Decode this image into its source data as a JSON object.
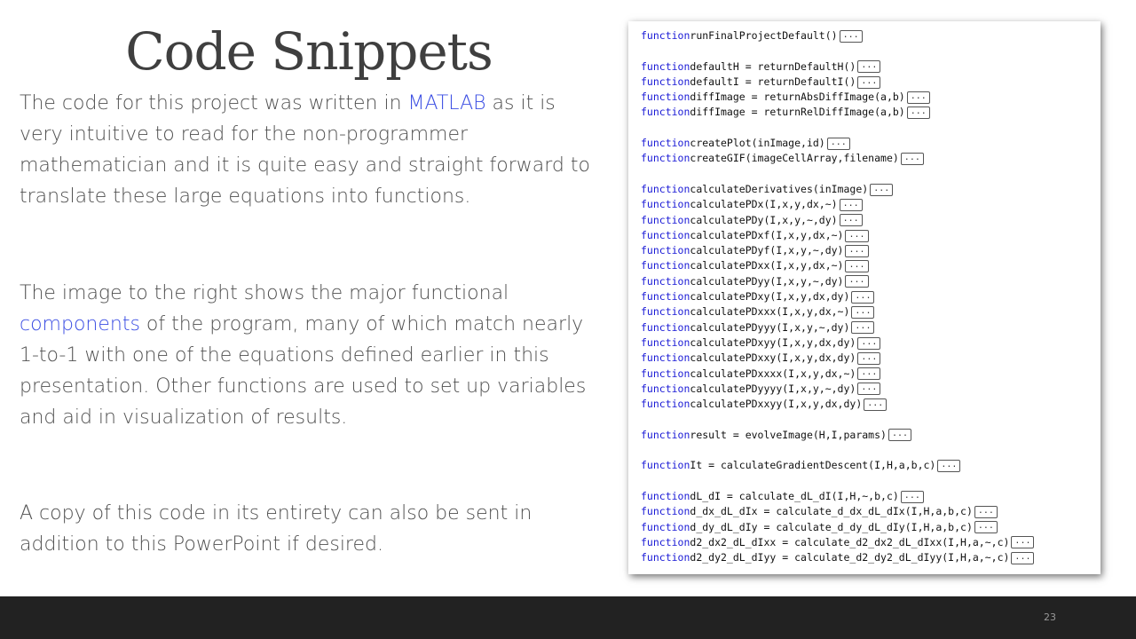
{
  "slide": {
    "title": "Code Snippets",
    "page_number": "23"
  },
  "paragraphs": {
    "p1": {
      "before": "The code for this project was written in ",
      "link": "MATLAB",
      "after": " as it is very intuitive to read for the non-programmer mathematician and it is quite easy and straight forward to translate these large equations into functions."
    },
    "p2": {
      "before": "The image to the right shows the major functional ",
      "link": "components",
      "after": " of the program, many of which match nearly 1-to-1 with one of the equations defined earlier in this presentation.  Other functions are used to set up variables and aid in visualization of results."
    },
    "p3": {
      "text": "A copy of this code in its entirety can also be sent in addition to this PowerPoint if desired."
    }
  },
  "code": {
    "keyword": "function",
    "fold_label": "...",
    "lines": [
      "runFinalProjectDefault()",
      "",
      "defaultH = returnDefaultH()",
      "defaultI = returnDefaultI()",
      "diffImage = returnAbsDiffImage(a,b)",
      "diffImage = returnRelDiffImage(a,b)",
      "",
      "createPlot(inImage,id)",
      "createGIF(imageCellArray,filename)",
      "",
      "calculateDerivatives(inImage)",
      "calculatePDx(I,x,y,dx,~)",
      "calculatePDy(I,x,y,~,dy)",
      "calculatePDxf(I,x,y,dx,~)",
      "calculatePDyf(I,x,y,~,dy)",
      "calculatePDxx(I,x,y,dx,~)",
      "calculatePDyy(I,x,y,~,dy)",
      "calculatePDxy(I,x,y,dx,dy)",
      "calculatePDxxx(I,x,y,dx,~)",
      "calculatePDyyy(I,x,y,~,dy)",
      "calculatePDxyy(I,x,y,dx,dy)",
      "calculatePDxxy(I,x,y,dx,dy)",
      "calculatePDxxxx(I,x,y,dx,~)",
      "calculatePDyyyy(I,x,y,~,dy)",
      "calculatePDxxyy(I,x,y,dx,dy)",
      "",
      "result = evolveImage(H,I,params)",
      "",
      "It = calculateGradientDescent(I,H,a,b,c)",
      "",
      "dL_dI = calculate_dL_dI(I,H,~,b,c)",
      "d_dx_dL_dIx = calculate_d_dx_dL_dIx(I,H,a,b,c)",
      "d_dy_dL_dIy = calculate_d_dy_dL_dIy(I,H,a,b,c)",
      "d2_dx2_dL_dIxx = calculate_d2_dx2_dL_dIxx(I,H,a,~,c)",
      "d2_dy2_dL_dIyy = calculate_d2_dy2_dL_dIyy(I,H,a,~,c)"
    ]
  }
}
